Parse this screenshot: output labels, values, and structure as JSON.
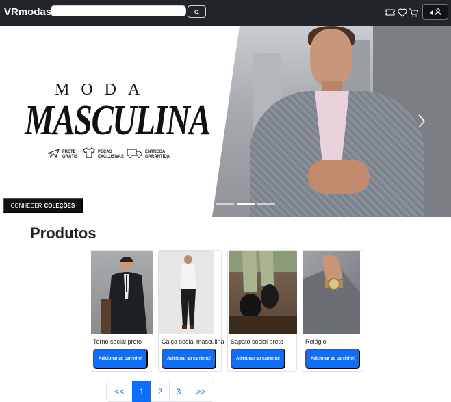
{
  "navbar": {
    "brand": "VRmodas",
    "search": {
      "value": "",
      "placeholder": ""
    },
    "icons": [
      "ticket-icon",
      "heart-icon",
      "cart-icon",
      "user-icon"
    ]
  },
  "hero": {
    "headline_small": "MODA",
    "headline_large": "MASCULINA",
    "perks": [
      {
        "icon": "plane-icon",
        "line1": "FRETE",
        "line2": "GRÁTIS"
      },
      {
        "icon": "shirt-icon",
        "line1": "PEÇAS",
        "line2": "EXCLUSIVAS"
      },
      {
        "icon": "truck-icon",
        "line1": "ENTREGA",
        "line2": "GARANTIDA"
      }
    ],
    "cta_prefix": "CONHECER",
    "cta_bold": "COLEÇÕES",
    "active_slide": 2,
    "slide_count": 3
  },
  "products": {
    "title": "Produtos",
    "items": [
      {
        "name": "Terno social preto",
        "button": "Adicionar ao carrinho!"
      },
      {
        "name": "Calça social masculina",
        "button": "Adicionar ao carrinho!"
      },
      {
        "name": "Sapato social preto",
        "button": "Adicionar ao carrinho!"
      },
      {
        "name": "Relógio",
        "button": "Adicionar ao carrinho!"
      }
    ]
  },
  "pagination": {
    "prev": "<<",
    "pages": [
      "1",
      "2",
      "3"
    ],
    "active": "1",
    "next": ">>"
  },
  "colors": {
    "navbar_bg": "#212529",
    "primary": "#0d6efd",
    "cta_bg": "#111111"
  }
}
